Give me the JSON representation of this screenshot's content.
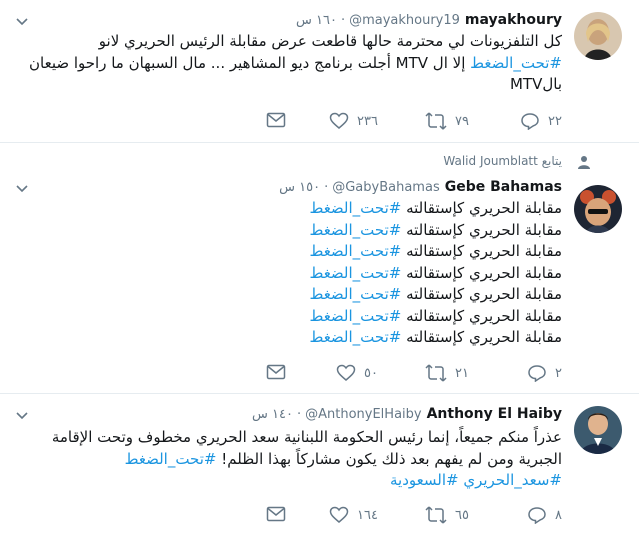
{
  "tweets": [
    {
      "name": "mayakhoury",
      "handle": "@mayakhoury19",
      "time": "١٦٠ س",
      "lines": [
        [
          {
            "t": "كل التلفزيونات لي محترمة حالها قاطعت عرض مقابلة الرئيس الحريري لانو ",
            "h": false
          }
        ],
        [
          {
            "t": "#تحت_الضغط",
            "h": true
          },
          {
            "t": "  إلا ال MTV أجلت برنامج ديو المشاهير ... مال السبهان ما راحوا ضيعان",
            "h": false
          }
        ],
        [
          {
            "t": "بالMTV",
            "h": false
          }
        ]
      ],
      "reply_count": "٢٢",
      "retweet_count": "٧٩",
      "like_count": "٢٣٦"
    },
    {
      "context": "Walid Joumblatt يتابع",
      "name": "Gebe Bahamas",
      "handle": "@GabyBahamas",
      "time": "١٥٠ س",
      "lines": [
        [
          {
            "t": "مقابلة الحريري كإستقالته ",
            "h": false
          },
          {
            "t": "#تحت_الضغط",
            "h": true
          }
        ],
        [
          {
            "t": "مقابلة الحريري كإستقالته ",
            "h": false
          },
          {
            "t": "#تحت_الضغط",
            "h": true
          }
        ],
        [
          {
            "t": "مقابلة الحريري كإستقالته ",
            "h": false
          },
          {
            "t": "#تحت_الضغط",
            "h": true
          }
        ],
        [
          {
            "t": "مقابلة الحريري كإستقالته ",
            "h": false
          },
          {
            "t": "#تحت_الضغط",
            "h": true
          }
        ],
        [
          {
            "t": "مقابلة الحريري كإستقالته ",
            "h": false
          },
          {
            "t": "#تحت_الضغط",
            "h": true
          }
        ],
        [
          {
            "t": "مقابلة الحريري كإستقالته ",
            "h": false
          },
          {
            "t": "#تحت_الضغط",
            "h": true
          }
        ],
        [
          {
            "t": "مقابلة الحريري كإستقالته ",
            "h": false
          },
          {
            "t": "#تحت_الضغط",
            "h": true
          }
        ]
      ],
      "reply_count": "٢",
      "retweet_count": "٢١",
      "like_count": "٥٠"
    },
    {
      "name": "Anthony El Haiby",
      "handle": "@AnthonyElHaiby",
      "time": "١٤٠ س",
      "lines": [
        [
          {
            "t": "عذراً منكم جميعاً، إنما رئيس الحكومة اللبنانية سعد الحريري مخطوف وتحت الإقامة",
            "h": false
          }
        ],
        [
          {
            "t": "الجبرية ومن لم يفهم بعد ذلك يكون مشاركاً بهذا الظلم! ",
            "h": false
          },
          {
            "t": "#تحت_الضغط",
            "h": true
          }
        ],
        [
          {
            "t": "#سعد_الحريري #السعودية",
            "h": true
          }
        ]
      ],
      "reply_count": "٨",
      "retweet_count": "٦٥",
      "like_count": "١٦٤"
    }
  ],
  "colors": {
    "accent": "#1b95e0",
    "muted": "#657786",
    "text": "#14171a",
    "border": "#e6ecf0"
  },
  "icons": [
    "reply-icon",
    "retweet-icon",
    "like-icon",
    "dm-icon",
    "chevron-down-icon",
    "follow-context-icon"
  ]
}
